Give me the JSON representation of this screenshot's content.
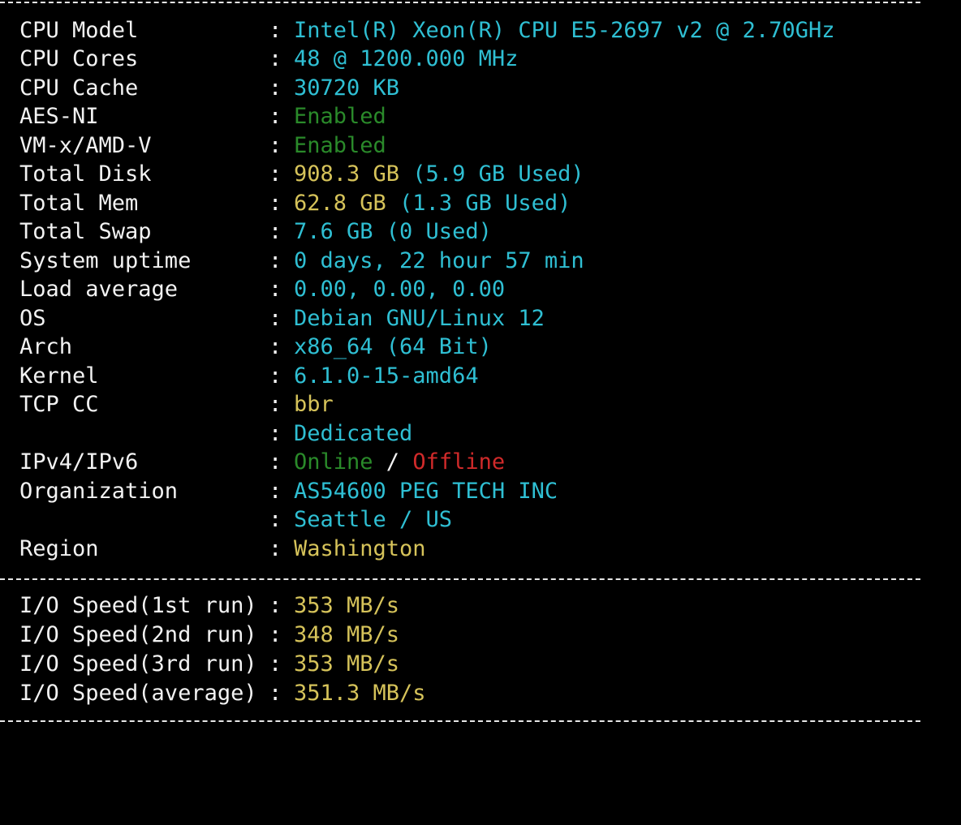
{
  "colors": {
    "background": "#000000",
    "label": "#f2f2f2",
    "cyan": "#2fbfd3",
    "green": "#2a8a2a",
    "yellow": "#d6c35a",
    "red": "#d02a2a"
  },
  "separator": "--------------------------------------------------------------------",
  "system_info": [
    {
      "label": "CPU Model",
      "value": "Intel(R) Xeon(R) CPU E5-2697 v2 @ 2.70GHz"
    },
    {
      "label": "CPU Cores",
      "value": "48 @ 1200.000 MHz"
    },
    {
      "label": "CPU Cache",
      "value": "30720 KB"
    },
    {
      "label": "AES-NI",
      "value": "Enabled"
    },
    {
      "label": "VM-x/AMD-V",
      "value": "Enabled"
    },
    {
      "label": "Total Disk",
      "value_main": "908.3 GB",
      "value_extra": " (5.9 GB Used)"
    },
    {
      "label": "Total Mem",
      "value_main": "62.8 GB",
      "value_extra": " (1.3 GB Used)"
    },
    {
      "label": "Total Swap",
      "value": "7.6 GB (0 Used)"
    },
    {
      "label": "System uptime",
      "value": "0 days, 22 hour 57 min"
    },
    {
      "label": "Load average",
      "value": "0.00, 0.00, 0.00"
    },
    {
      "label": "OS",
      "value": "Debian GNU/Linux 12"
    },
    {
      "label": "Arch",
      "value": "x86_64 (64 Bit)"
    },
    {
      "label": "Kernel",
      "value": "6.1.0-15-amd64"
    },
    {
      "label": "TCP CC",
      "value": "bbr"
    },
    {
      "label": "",
      "value": "Dedicated"
    },
    {
      "label": "IPv4/IPv6",
      "value_online": "Online",
      "value_slash": " / ",
      "value_offline": "Offline"
    },
    {
      "label": "Organization",
      "value": "AS54600 PEG TECH INC"
    },
    {
      "label": "",
      "value": "Seattle / US"
    },
    {
      "label": "Region",
      "value": "Washington"
    }
  ],
  "io_info": [
    {
      "label": "I/O Speed(1st run)",
      "value": "353 MB/s"
    },
    {
      "label": "I/O Speed(2nd run)",
      "value": "348 MB/s"
    },
    {
      "label": "I/O Speed(3rd run)",
      "value": "353 MB/s"
    },
    {
      "label": "I/O Speed(average)",
      "value": "351.3 MB/s"
    }
  ],
  "colon": ":"
}
